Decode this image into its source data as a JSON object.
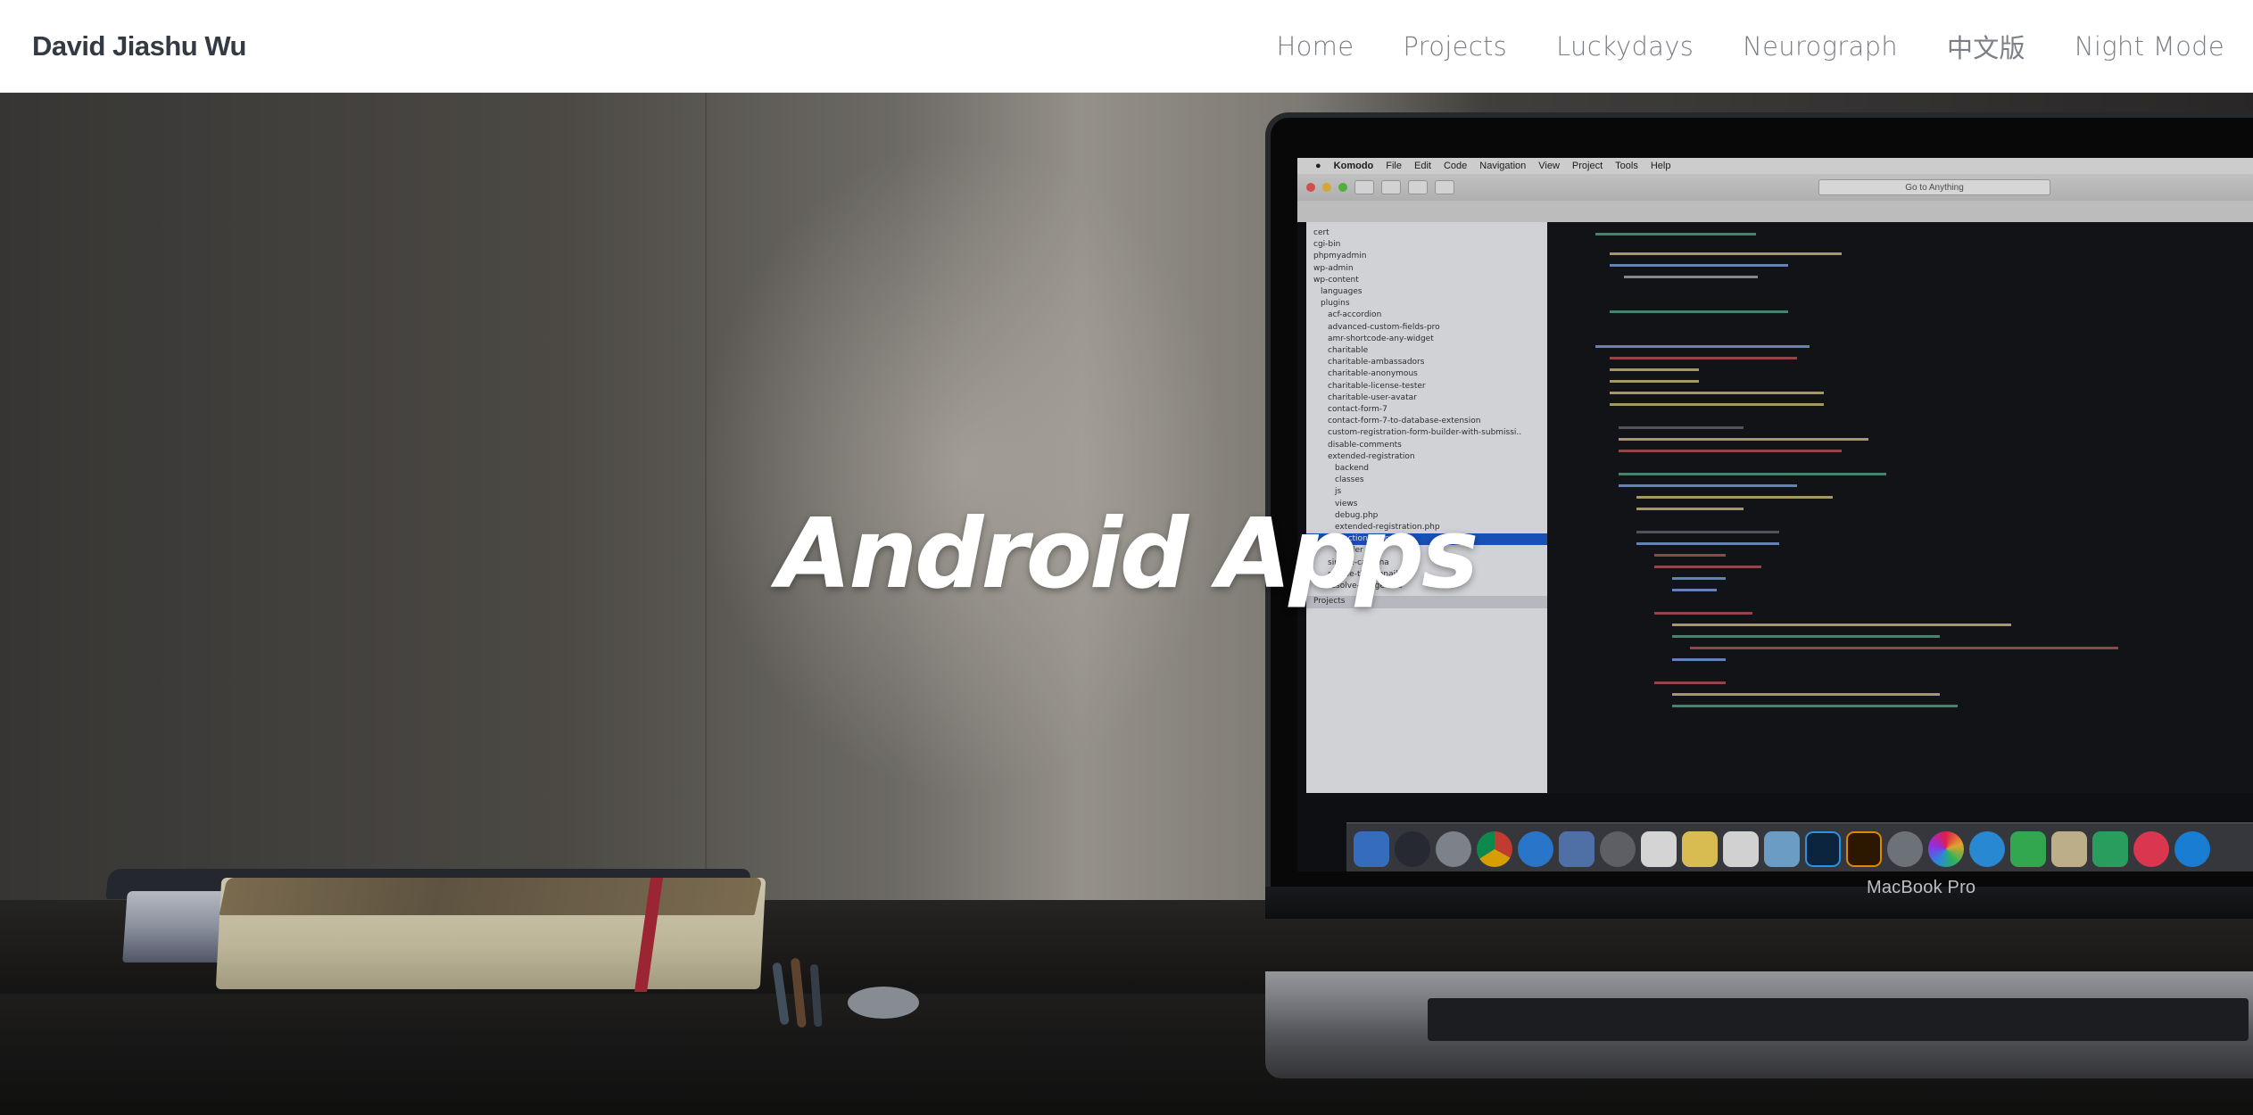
{
  "navbar": {
    "brand": "David Jiashu Wu",
    "links": [
      {
        "label": "Home"
      },
      {
        "label": "Projects"
      },
      {
        "label": "Luckydays"
      },
      {
        "label": "Neurograph"
      },
      {
        "label": "中文版"
      },
      {
        "label": "Night Mode"
      }
    ]
  },
  "hero": {
    "title": "Android Apps",
    "laptop_label": "MacBook Pro",
    "screen": {
      "menubar": [
        "Komodo",
        "File",
        "Edit",
        "Code",
        "Navigation",
        "View",
        "Project",
        "Tools",
        "Help"
      ],
      "goto_label": "Go to Anything",
      "file_tree": [
        "cert",
        "cgi-bin",
        "phpmyadmin",
        "wp-admin",
        "wp-content",
        "languages",
        "plugins",
        "acf-accordion",
        "advanced-custom-fields-pro",
        "amr-shortcode-any-widget",
        "charitable",
        "charitable-ambassadors",
        "charitable-anonymous",
        "charitable-license-tester",
        "charitable-user-avatar",
        "contact-form-7",
        "contact-form-7-to-database-extension",
        "custom-registration-form-builder-with-submissi..",
        "disable-comments",
        "extended-registration",
        "backend",
        "classes",
        "js",
        "views",
        "debug.php",
        "extended-registration.php",
        "functions.php",
        "header",
        "simple-captcha",
        "simple-thumbnails",
        "resolve-image-urls"
      ],
      "tree_footer": "Projects"
    }
  },
  "colors": {
    "brand": "#333a44",
    "nav_link": "#7b7f86",
    "hero_title": "#ffffff"
  }
}
